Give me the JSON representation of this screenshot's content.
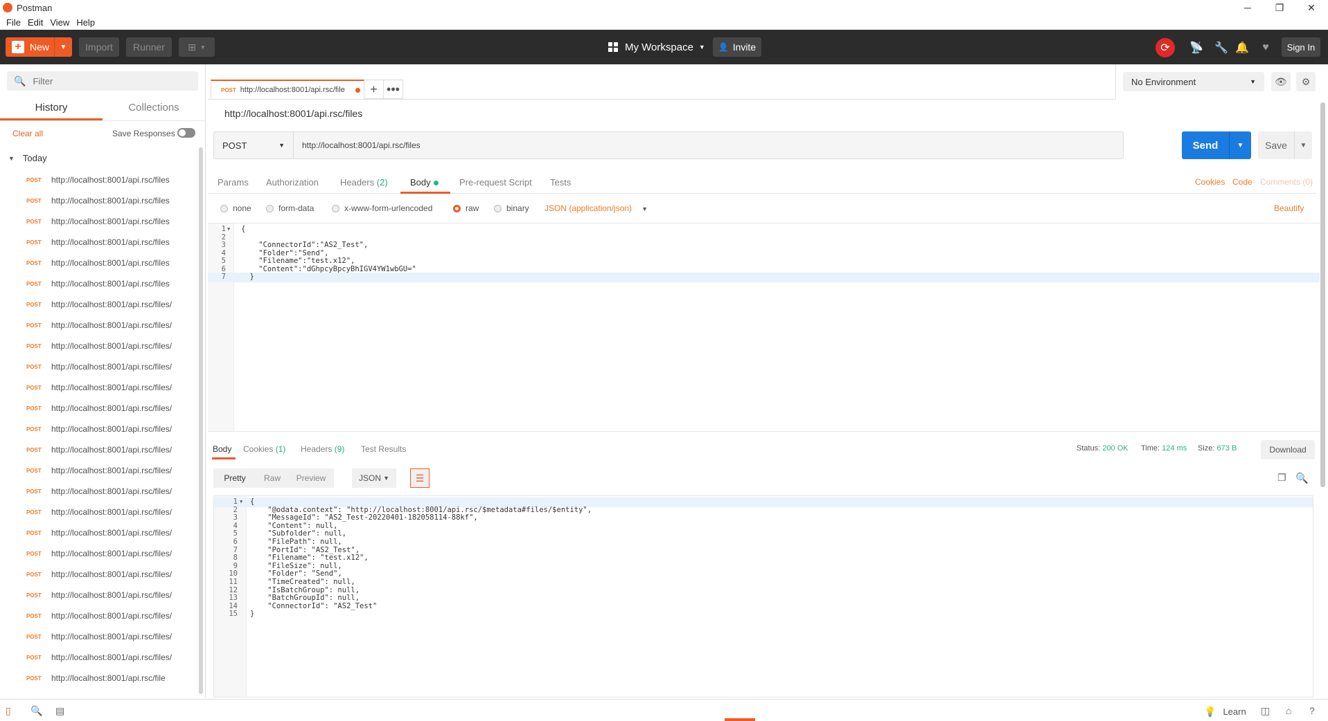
{
  "window": {
    "title": "Postman",
    "minimize": "─",
    "maximize": "❐",
    "close": "✕"
  },
  "menu": [
    "File",
    "Edit",
    "View",
    "Help"
  ],
  "header": {
    "new_label": "New",
    "import_label": "Import",
    "runner_label": "Runner",
    "workspace_label": "My Workspace",
    "invite_label": "Invite",
    "signin_label": "Sign In"
  },
  "sidebar": {
    "filter_placeholder": "Filter",
    "tabs": [
      "History",
      "Collections"
    ],
    "clear_all": "Clear all",
    "save_responses": "Save Responses",
    "group": "Today",
    "history": [
      {
        "method": "POST",
        "url": "http://localhost:8001/api.rsc/files"
      },
      {
        "method": "POST",
        "url": "http://localhost:8001/api.rsc/files"
      },
      {
        "method": "POST",
        "url": "http://localhost:8001/api.rsc/files"
      },
      {
        "method": "POST",
        "url": "http://localhost:8001/api.rsc/files"
      },
      {
        "method": "POST",
        "url": "http://localhost:8001/api.rsc/files"
      },
      {
        "method": "POST",
        "url": "http://localhost:8001/api.rsc/files"
      },
      {
        "method": "POST",
        "url": "http://localhost:8001/api.rsc/files/"
      },
      {
        "method": "POST",
        "url": "http://localhost:8001/api.rsc/files/"
      },
      {
        "method": "POST",
        "url": "http://localhost:8001/api.rsc/files/"
      },
      {
        "method": "POST",
        "url": "http://localhost:8001/api.rsc/files/"
      },
      {
        "method": "POST",
        "url": "http://localhost:8001/api.rsc/files/"
      },
      {
        "method": "POST",
        "url": "http://localhost:8001/api.rsc/files/"
      },
      {
        "method": "POST",
        "url": "http://localhost:8001/api.rsc/files/"
      },
      {
        "method": "POST",
        "url": "http://localhost:8001/api.rsc/files/"
      },
      {
        "method": "POST",
        "url": "http://localhost:8001/api.rsc/files/"
      },
      {
        "method": "POST",
        "url": "http://localhost:8001/api.rsc/files/"
      },
      {
        "method": "POST",
        "url": "http://localhost:8001/api.rsc/files/"
      },
      {
        "method": "POST",
        "url": "http://localhost:8001/api.rsc/files/"
      },
      {
        "method": "POST",
        "url": "http://localhost:8001/api.rsc/files/"
      },
      {
        "method": "POST",
        "url": "http://localhost:8001/api.rsc/files/"
      },
      {
        "method": "POST",
        "url": "http://localhost:8001/api.rsc/files/"
      },
      {
        "method": "POST",
        "url": "http://localhost:8001/api.rsc/files/"
      },
      {
        "method": "POST",
        "url": "http://localhost:8001/api.rsc/files/"
      },
      {
        "method": "POST",
        "url": "http://localhost:8001/api.rsc/files/"
      },
      {
        "method": "POST",
        "url": "http://localhost:8001/api.rsc/file"
      }
    ]
  },
  "request_tab": {
    "method": "POST",
    "url": "http://localhost:8001/api.rsc/file"
  },
  "environment": {
    "selected": "No Environment"
  },
  "request": {
    "name": "http://localhost:8001/api.rsc/files",
    "method": "POST",
    "url": "http://localhost:8001/api.rsc/files",
    "send_label": "Send",
    "save_label": "Save",
    "tabs": {
      "params": "Params",
      "authorization": "Authorization",
      "headers": "Headers",
      "headers_count": "(2)",
      "body": "Body",
      "prerequest": "Pre-request Script",
      "tests": "Tests"
    },
    "links": {
      "cookies": "Cookies",
      "code": "Code",
      "comments": "Comments (0)"
    },
    "body_modes": [
      "none",
      "form-data",
      "x-www-form-urlencoded",
      "raw",
      "binary"
    ],
    "content_type": "JSON (application/json)",
    "beautify": "Beautify",
    "body_lines": [
      "{",
      "",
      "    \"ConnectorId\":\"AS2_Test\",",
      "    \"Folder\":\"Send\",",
      "    \"Filename\":\"test.x12\",",
      "    \"Content\":\"dGhpcyBpcyBhIGV4YW1wbGU=\"",
      "  }"
    ]
  },
  "response": {
    "tabs": {
      "body": "Body",
      "cookies": "Cookies",
      "cookies_count": "(1)",
      "headers": "Headers",
      "headers_count": "(9)",
      "tests": "Test Results"
    },
    "status_label": "Status:",
    "status": "200 OK",
    "time_label": "Time:",
    "time": "124 ms",
    "size_label": "Size:",
    "size": "673 B",
    "download": "Download",
    "views": [
      "Pretty",
      "Raw",
      "Preview"
    ],
    "format": "JSON",
    "body_lines": [
      "{",
      "    \"@odata.context\": \"http://localhost:8001/api.rsc/$metadata#files/$entity\",",
      "    \"MessageId\": \"AS2_Test-20220401-182058114-88kf\",",
      "    \"Content\": null,",
      "    \"Subfolder\": null,",
      "    \"FilePath\": null,",
      "    \"PortId\": \"AS2_Test\",",
      "    \"Filename\": \"test.x12\",",
      "    \"FileSize\": null,",
      "    \"Folder\": \"Send\",",
      "    \"TimeCreated\": null,",
      "    \"IsBatchGroup\": null,",
      "    \"BatchGroupId\": null,",
      "    \"ConnectorId\": \"AS2_Test\"",
      "}"
    ]
  },
  "footer": {
    "learn": "Learn"
  }
}
